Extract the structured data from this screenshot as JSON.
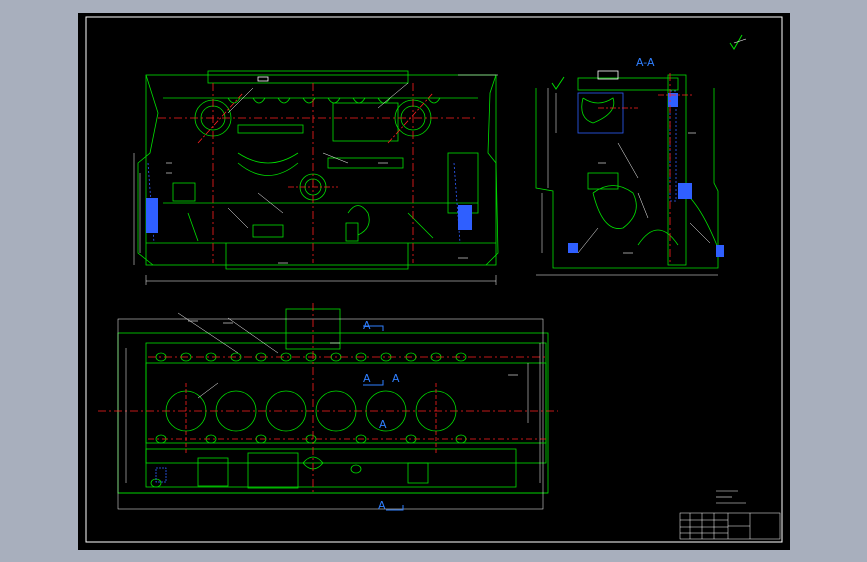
{
  "drawing": {
    "section_title": "A-A",
    "section_marks": [
      "A",
      "A",
      "A",
      "A",
      "A"
    ],
    "colors": {
      "background": "#a8afbd",
      "viewport": "#000000",
      "outline": "#00e000",
      "center_line": "#ff2020",
      "dimension": "#ffffff",
      "hatch": "#2f5fff",
      "label": "#2f7fff"
    },
    "roughness_icon": "roughness-symbol-icon"
  }
}
